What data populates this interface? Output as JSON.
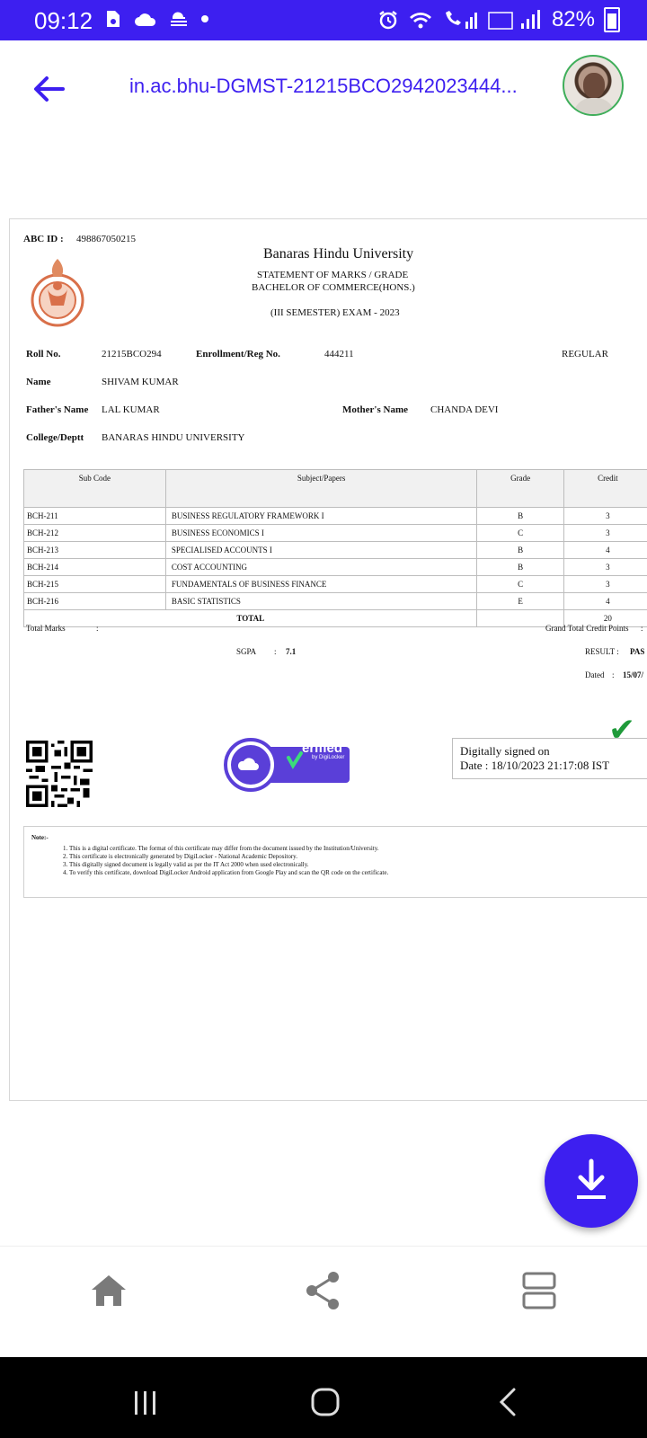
{
  "status_bar": {
    "time": "09:12",
    "battery": "82%",
    "colors": {
      "background": "#3d1ff0"
    }
  },
  "app_bar": {
    "title": "in.ac.bhu-DGMST-21215BCO2942023444...",
    "accent": "#3d1ff0"
  },
  "document": {
    "abc_id_label": "ABC ID :",
    "abc_id_value": "498867050215",
    "university": "Banaras Hindu University",
    "statement": "STATEMENT OF MARKS / GRADE",
    "programme": "BACHELOR OF COMMERCE(HONS.)",
    "exam": "(III SEMESTER) EXAM - 2023",
    "roll_label": "Roll No.",
    "roll_value": "21215BCO294",
    "enroll_label": "Enrollment/Reg No.",
    "enroll_value": "444211",
    "status": "REGULAR",
    "name_label": "Name",
    "name_value": "SHIVAM KUMAR",
    "father_label": "Father's Name",
    "father_value": "LAL KUMAR",
    "mother_label": "Mother's Name",
    "mother_value": "CHANDA DEVI",
    "college_label": "College/Deptt",
    "college_value": "BANARAS HINDU UNIVERSITY",
    "table": {
      "headers": [
        "Sub Code",
        "Subject/Papers",
        "Grade",
        "Credit"
      ],
      "rows": [
        [
          "BCH-211",
          "BUSINESS REGULATORY FRAMEWORK I",
          "B",
          "3"
        ],
        [
          "BCH-212",
          "BUSINESS ECONOMICS I",
          "C",
          "3"
        ],
        [
          "BCH-213",
          "SPECIALISED ACCOUNTS I",
          "B",
          "4"
        ],
        [
          "BCH-214",
          "COST ACCOUNTING",
          "B",
          "3"
        ],
        [
          "BCH-215",
          "FUNDAMENTALS OF BUSINESS FINANCE",
          "C",
          "3"
        ],
        [
          "BCH-216",
          "BASIC STATISTICS",
          "E",
          "4"
        ]
      ],
      "total_label": "TOTAL",
      "total_credit": "20"
    },
    "total_marks_label": "Total Marks",
    "colon": ":",
    "grand_total_label": "Grand Total Credit Points",
    "sgpa_label": "SGPA",
    "sgpa_value": "7.1",
    "result_label": "RESULT :",
    "result_value": "PAS",
    "dated_label": "Dated",
    "dated_value": "15/07/",
    "verified_text": "erified",
    "verified_by": "by DigiLocker",
    "signed_line1": "Digitally signed on",
    "signed_line2": "Date : 18/10/2023 21:17:08 IST",
    "note_label": "Note:-",
    "notes": [
      "This is a digital certificate. The format of this certificate may differ from the document issued by the Institution/University.",
      "This certificate is electronically generated by DigiLocker - National Academic Depository.",
      "This digitally signed document is legally valid as per the IT Act 2000 when used electronically.",
      "To verify this certificate, download DigiLocker Android application from Google Play and scan the QR code on the certificate."
    ]
  },
  "icons": {
    "back": "arrow-left-icon",
    "download": "download-icon",
    "home": "home-icon",
    "share": "share-icon",
    "view": "view-toggle-icon"
  }
}
